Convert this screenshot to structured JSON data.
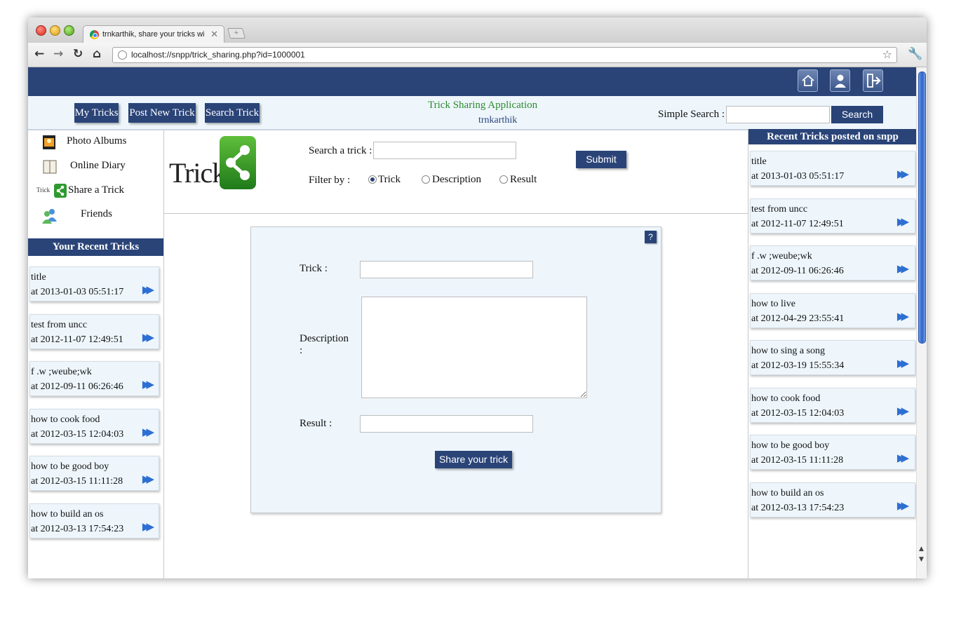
{
  "browser": {
    "tab_title": "trnkarthik, share your tricks with f",
    "tab_close": "✕",
    "new_tab": "+",
    "url": "localhost://snpp/trick_sharing.php?id=1000001",
    "back": "←",
    "forward": "→",
    "reload": "↻",
    "home": "⌂",
    "star": "☆",
    "wrench": "🔧"
  },
  "header": {
    "icons": [
      "home-icon",
      "profile-icon",
      "logout-icon"
    ]
  },
  "menu": {
    "my_tricks": "My Tricks",
    "post_new_trick": "Post New Trick",
    "search_trick": "Search Trick",
    "app_title": "Trick Sharing Application",
    "username": "trnkarthik",
    "simple_search_label": "Simple Search :",
    "simple_search_value": "",
    "search_button": "Search"
  },
  "left_nav": {
    "items": [
      {
        "label": "Photo Albums",
        "icon": "photo-album-icon"
      },
      {
        "label": "Online Diary",
        "icon": "diary-icon"
      },
      {
        "label": "Share a Trick",
        "icon": "share-icon",
        "icon_text": "Trick"
      },
      {
        "label": "Friends",
        "icon": "friends-icon"
      }
    ],
    "recent_heading": "Your Recent Tricks",
    "recent": [
      {
        "title": "title",
        "date": "at 2013-01-03 05:51:17"
      },
      {
        "title": "test from uncc",
        "date": "at 2012-11-07 12:49:51"
      },
      {
        "title": "f .w ;weube;wk",
        "date": "at 2012-09-11 06:26:46"
      },
      {
        "title": "how to cook food",
        "date": "at 2012-03-15 12:04:03"
      },
      {
        "title": "how to be good boy",
        "date": "at 2012-03-15 11:11:28"
      },
      {
        "title": "how to build an os",
        "date": "at 2012-03-13 17:54:23"
      }
    ]
  },
  "center": {
    "logo_text": "Trick",
    "search_label": "Search a trick :",
    "search_value": "",
    "submit": "Submit",
    "filter_label": "Filter by :",
    "filters": [
      {
        "label": "Trick",
        "checked": true
      },
      {
        "label": "Description",
        "checked": false
      },
      {
        "label": "Result",
        "checked": false
      }
    ],
    "form": {
      "help": "?",
      "trick_label": "Trick :",
      "description_label": "Description :",
      "result_label": "Result :",
      "trick_value": "",
      "description_value": "",
      "result_value": "",
      "share_button": "Share your trick"
    }
  },
  "right_nav": {
    "heading": "Recent Tricks posted on snpp",
    "recent": [
      {
        "title": "title",
        "date": "at 2013-01-03 05:51:17"
      },
      {
        "title": "test from uncc",
        "date": "at 2012-11-07 12:49:51"
      },
      {
        "title": "f .w ;weube;wk",
        "date": "at 2012-09-11 06:26:46"
      },
      {
        "title": "how to live",
        "date": "at 2012-04-29 23:55:41"
      },
      {
        "title": "how to sing a song",
        "date": "at 2012-03-19 15:55:34"
      },
      {
        "title": "how to cook food",
        "date": "at 2012-03-15 12:04:03"
      },
      {
        "title": "how to be good boy",
        "date": "at 2012-03-15 11:11:28"
      },
      {
        "title": "how to build an os",
        "date": "at 2012-03-13 17:54:23"
      }
    ]
  },
  "colors": {
    "primary": "#2a4478",
    "panel_bg": "#eef6fc",
    "title_green": "#2e8b2e",
    "arrow_blue": "#2d6fd2"
  }
}
